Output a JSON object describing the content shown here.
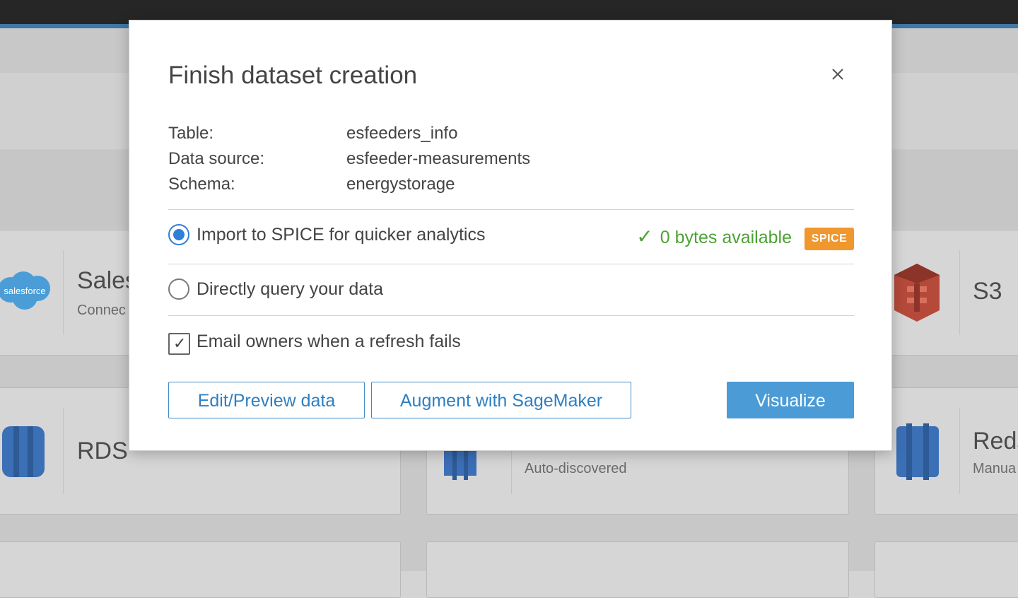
{
  "background": {
    "cards": [
      {
        "title": "Sales",
        "subtitle": "Connec",
        "logo_text": "salesforce"
      },
      {
        "title": "S3",
        "subtitle": ""
      },
      {
        "title": "RDS",
        "subtitle": ""
      },
      {
        "title": "",
        "subtitle": "Auto-discovered"
      },
      {
        "title": "Reds",
        "subtitle": "Manua"
      }
    ]
  },
  "modal": {
    "title": "Finish dataset creation",
    "close_icon": "close-icon",
    "info": [
      {
        "key": "Table:",
        "value": "esfeeders_info"
      },
      {
        "key": "Data source:",
        "value": "esfeeder-measurements"
      },
      {
        "key": "Schema:",
        "value": "energystorage"
      }
    ],
    "options": {
      "import_spice": {
        "label": "Import to SPICE for quicker analytics",
        "checked": true
      },
      "availability": {
        "check": "✓",
        "text": "0 bytes available"
      },
      "spice_badge": "SPICE",
      "direct_query": {
        "label": "Directly query your data",
        "checked": false
      }
    },
    "email_owners": {
      "label": "Email owners when a refresh fails",
      "check": "✓",
      "checked": true
    },
    "buttons": {
      "edit_preview": "Edit/Preview data",
      "augment": "Augment with SageMaker",
      "visualize": "Visualize"
    },
    "colors": {
      "accent": "#2f7ed8",
      "success": "#4ca234",
      "badge": "#f0972d",
      "primary_button": "#4a9bd6"
    }
  }
}
